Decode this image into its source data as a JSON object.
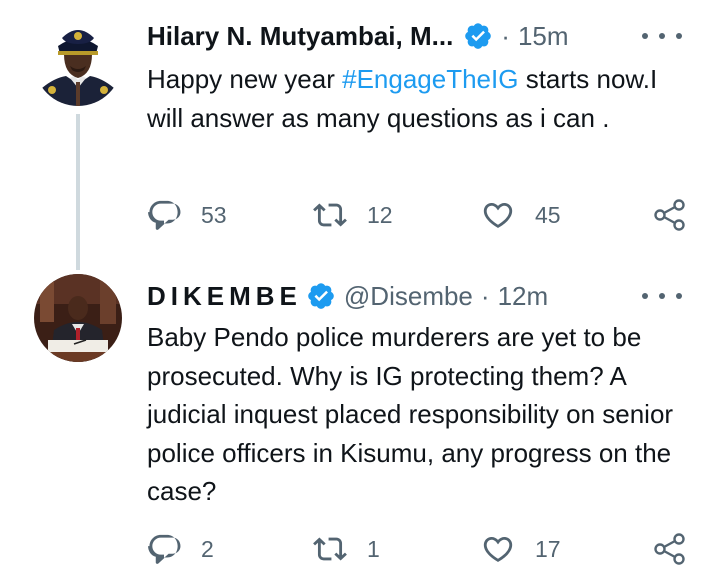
{
  "tweets": [
    {
      "name": "Hilary N. Mutyambai, M...",
      "handle": "",
      "separator": "·",
      "time": "15m",
      "text_before": "Happy new year ",
      "hashtag": "#EngageTheIG",
      "text_after": " starts now.I will answer as many questions as i can .",
      "replies": "53",
      "retweets": "12",
      "likes": "45",
      "avatar_icon": "uniformed-officer-avatar"
    },
    {
      "name": "DIKEMBE",
      "handle": "@Disembe",
      "separator": "·",
      "time": "12m",
      "text": "Baby Pendo police murderers are yet to be prosecuted. Why is IG protecting them? A judicial inquest placed responsibility on senior police officers in Kisumu, any progress on the case?",
      "replies": "2",
      "retweets": "1",
      "likes": "17",
      "avatar_icon": "man-signing-document-avatar"
    }
  ],
  "colors": {
    "text": "#0f1419",
    "secondary": "#536471",
    "link": "#1d9bf0",
    "verified": "#1d9bf0",
    "thread_line": "#cfd9de"
  }
}
